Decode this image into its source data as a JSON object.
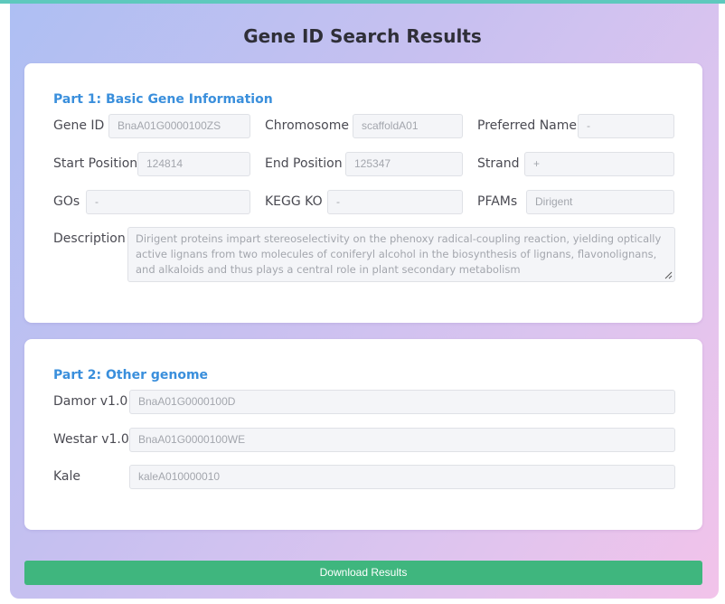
{
  "page": {
    "title": "Gene ID Search Results"
  },
  "part1": {
    "title": "Part 1: Basic Gene Information",
    "gene_id": {
      "label": "Gene ID",
      "value": "BnaA01G0000100ZS"
    },
    "chromosome": {
      "label": "Chromosome",
      "value": "scaffoldA01"
    },
    "preferred_name": {
      "label": "Preferred Name",
      "value": "-"
    },
    "start_position": {
      "label": "Start Position",
      "value": "124814"
    },
    "end_position": {
      "label": "End Position",
      "value": "125347"
    },
    "strand": {
      "label": "Strand",
      "value": "+"
    },
    "gos": {
      "label": "GOs",
      "value": "-"
    },
    "kegg_ko": {
      "label": "KEGG KO",
      "value": "-"
    },
    "pfams": {
      "label": "PFAMs",
      "value": "Dirigent"
    },
    "description": {
      "label": "Description",
      "value": "Dirigent proteins impart stereoselectivity on the phenoxy radical-coupling reaction, yielding optically active lignans from two molecules of coniferyl alcohol in the biosynthesis of lignans, flavonolignans, and alkaloids and thus plays a central role in plant secondary metabolism"
    }
  },
  "part2": {
    "title": "Part 2: Other genome",
    "damor": {
      "label": "Damor v1.0",
      "value": "BnaA01G0000100D"
    },
    "westar": {
      "label": "Westar v1.0",
      "value": "BnaA01G0000100WE"
    },
    "kale": {
      "label": "Kale",
      "value": "kaleA010000010"
    }
  },
  "download_button": {
    "label": "Download Results"
  },
  "colors": {
    "accent": "#3a8fdc",
    "button": "#3fb67e",
    "top_bar": "#5ec9bd"
  },
  "icons": {
    "resize": "resize-handle-icon"
  }
}
